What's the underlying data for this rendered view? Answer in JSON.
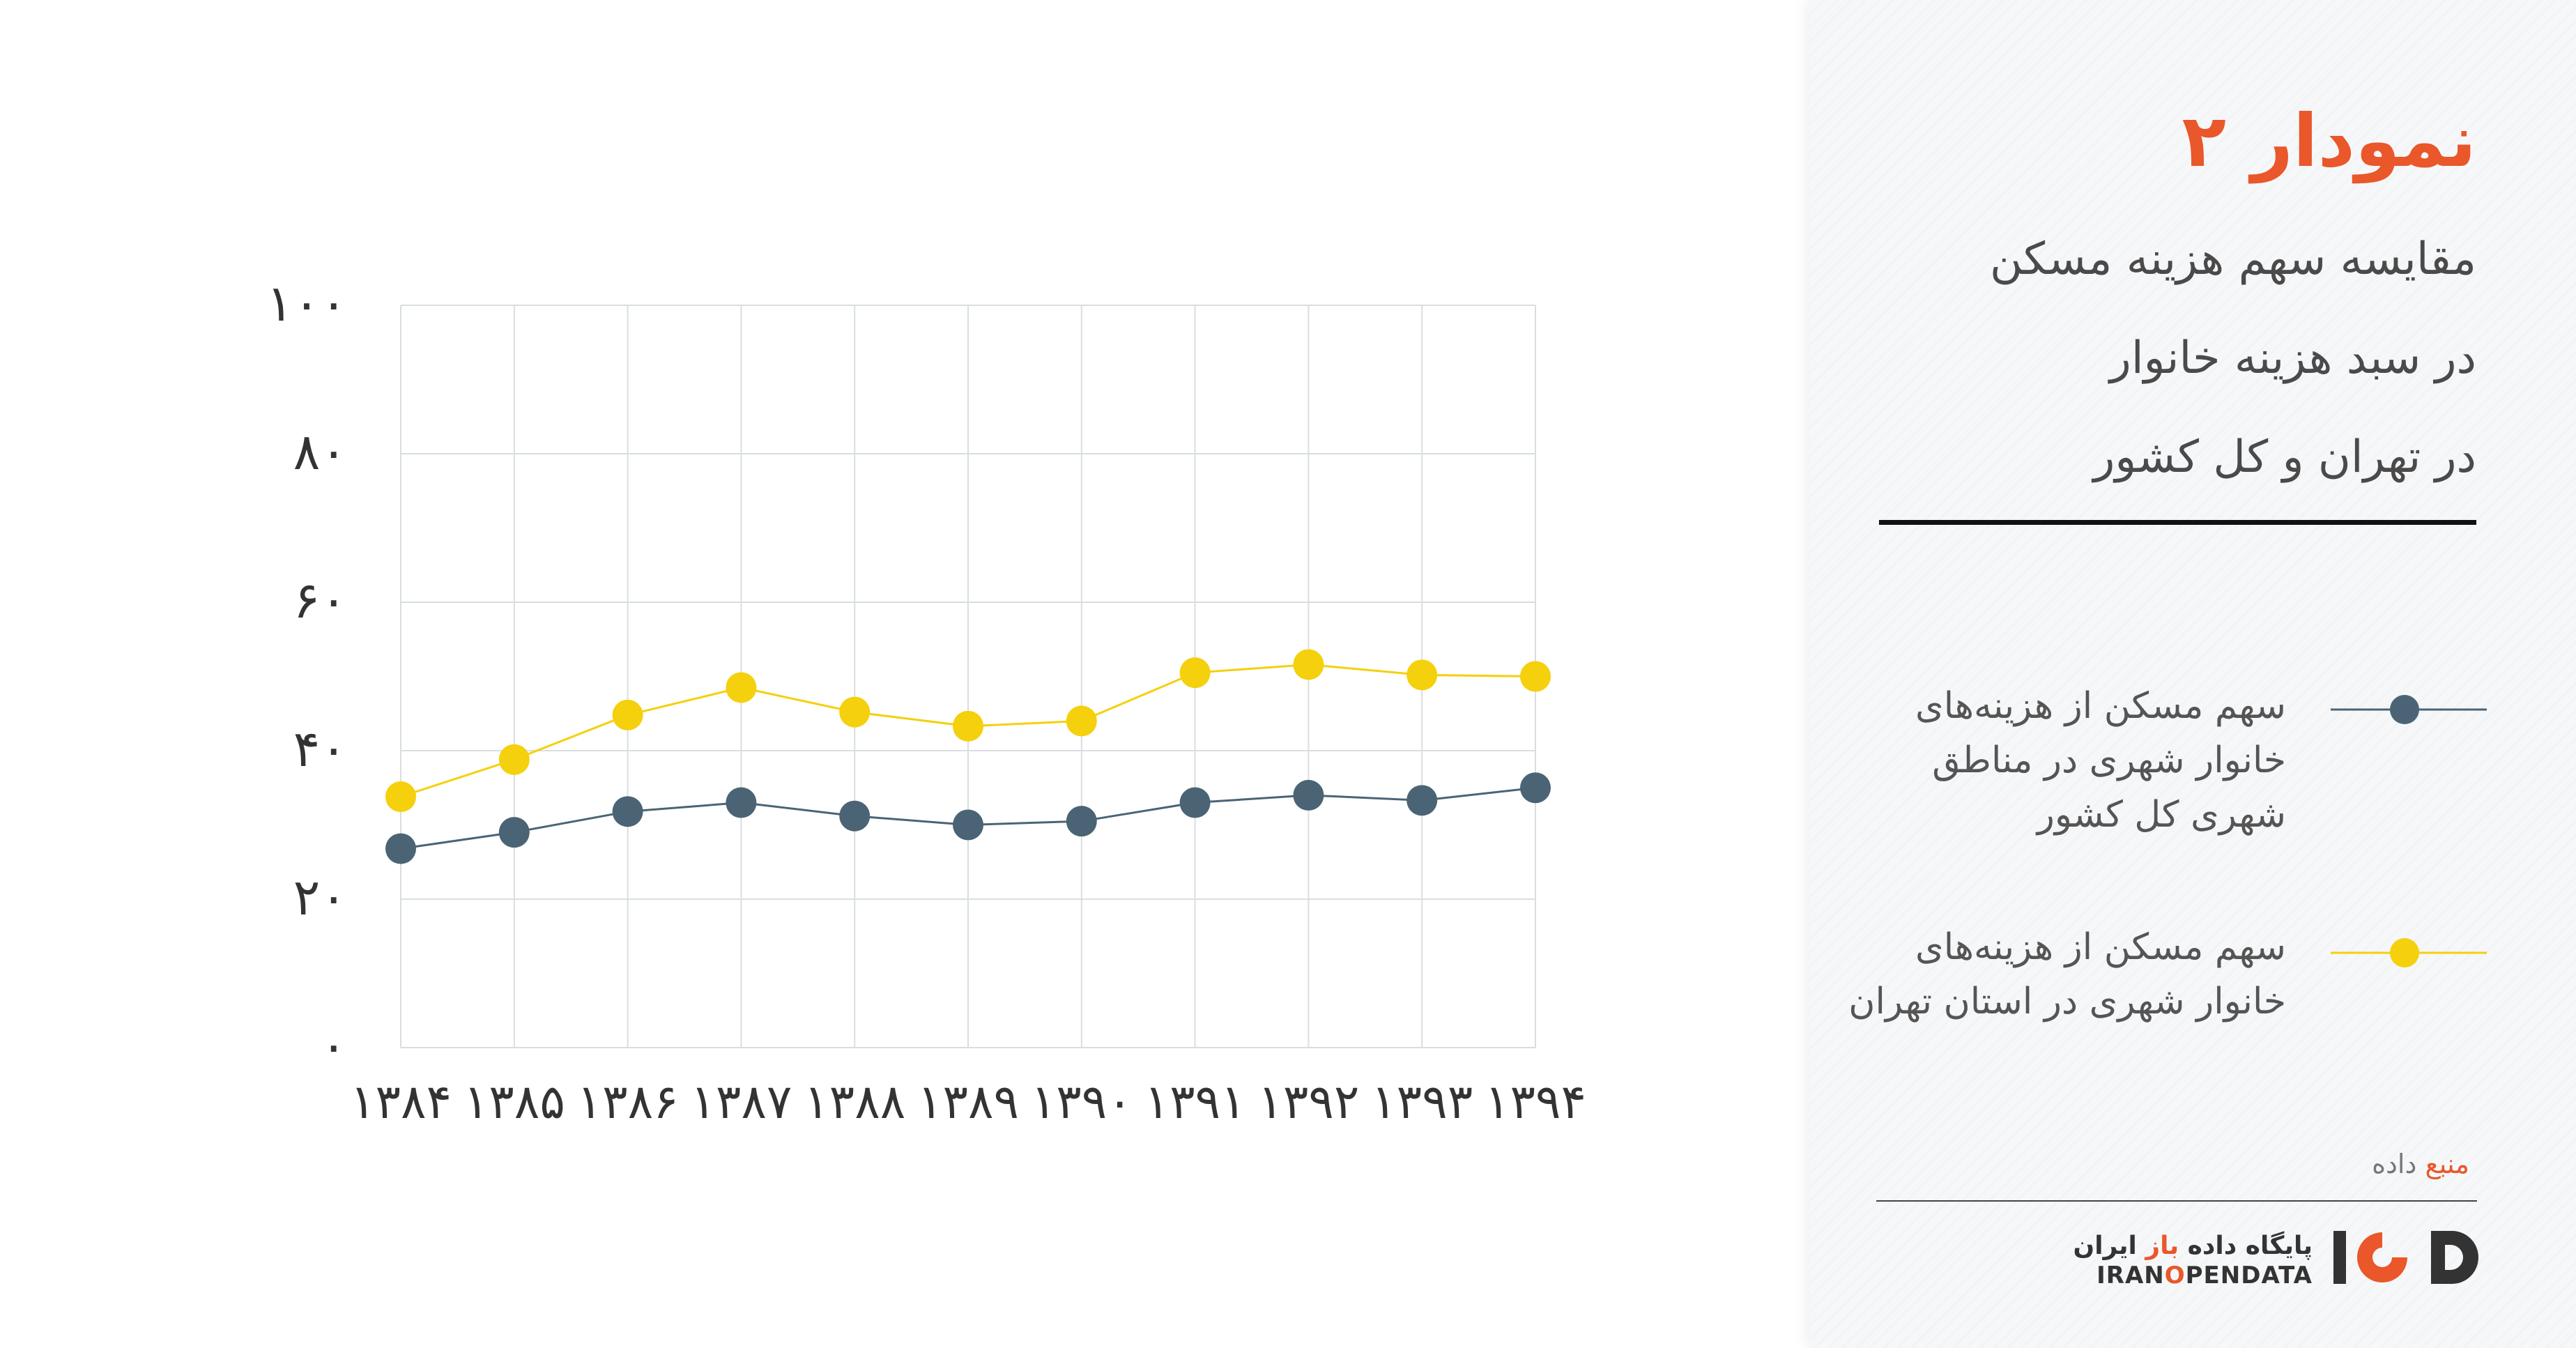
{
  "chart_data": {
    "type": "line",
    "categories": [
      "۱۳۸۴",
      "۱۳۸۵",
      "۱۳۸۶",
      "۱۳۸۷",
      "۱۳۸۸",
      "۱۳۸۹",
      "۱۳۹۰",
      "۱۳۹۱",
      "۱۳۹۲",
      "۱۳۹۳",
      "۱۳۹۴"
    ],
    "y_ticks": [
      "۰",
      "۲۰",
      "۴۰",
      "۶۰",
      "۸۰",
      "۱۰۰"
    ],
    "ylim": [
      0,
      100
    ],
    "grid": true,
    "legend_placement": "right",
    "series": [
      {
        "name": "سهم مسکن از هزینه‌های خانوار شهری در مناطق شهری کل کشور",
        "color": "#4a6475",
        "values": [
          26.8,
          29.0,
          31.8,
          33.0,
          31.2,
          30.0,
          30.5,
          33.0,
          34.0,
          33.3,
          35.0
        ]
      },
      {
        "name": "سهم مسکن از هزینه‌های خانوار شهری در استان تهران",
        "color": "#f5d00c",
        "values": [
          33.8,
          38.8,
          44.8,
          48.5,
          45.2,
          43.3,
          44.0,
          50.5,
          51.6,
          50.2,
          50.0
        ]
      }
    ]
  },
  "panel": {
    "title": "نمودار ۲",
    "subtitle_lines": [
      "مقایسه سهم هزینه مسکن",
      "در سبد هزینه خانوار",
      "در تهران و کل کشور"
    ],
    "legend": [
      {
        "lines": [
          "سهم مسکن از هزینه‌های",
          "خانوار شهری در مناطق",
          "شهری کل کشور"
        ]
      },
      {
        "lines": [
          "سهم مسکن از هزینه‌های",
          "خانوار شهری در استان تهران"
        ]
      }
    ],
    "source_label_accent": "منبع",
    "source_label_rest": " داده",
    "logo_fa_prefix": "پایگاه داده ",
    "logo_fa_accent": "باز",
    "logo_fa_suffix": " ایران",
    "logo_en_start": "IRAN",
    "logo_en_accent": "O",
    "logo_en_end": "PENDATA",
    "logo_mark_text": "IOD"
  },
  "colors": {
    "accent": "#e9572a",
    "series_dark": "#4a6475",
    "series_yellow": "#f5d00c",
    "grid": "#d8dee0"
  }
}
